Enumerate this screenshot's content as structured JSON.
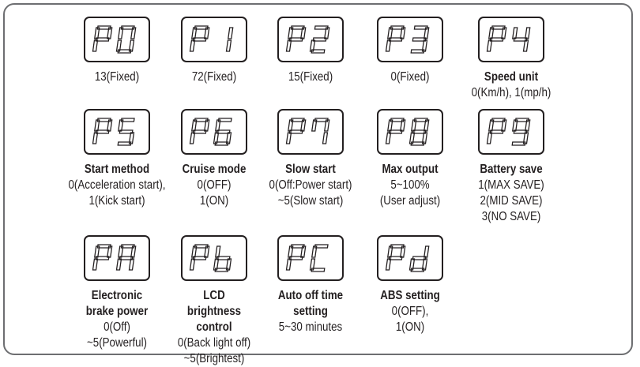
{
  "params": [
    {
      "code": "P0",
      "title": "",
      "values": [
        "13(Fixed)"
      ]
    },
    {
      "code": "P1",
      "title": "",
      "values": [
        "72(Fixed)"
      ]
    },
    {
      "code": "P2",
      "title": "",
      "values": [
        "15(Fixed)"
      ]
    },
    {
      "code": "P3",
      "title": "",
      "values": [
        "0(Fixed)"
      ]
    },
    {
      "code": "P4",
      "title": "Speed unit",
      "values": [
        "0(Km/h), 1(mp/h)"
      ]
    },
    {
      "code": "P5",
      "title": "Start method",
      "values": [
        "0(Acceleration start),",
        "1(Kick start)"
      ]
    },
    {
      "code": "P6",
      "title": "Cruise mode",
      "values": [
        "0(OFF)",
        "1(ON)"
      ]
    },
    {
      "code": "P7",
      "title": "Slow start",
      "values": [
        "0(Off:Power start)",
        "~5(Slow start)"
      ]
    },
    {
      "code": "P8",
      "title": "Max output",
      "values": [
        "5~100%",
        "(User adjust)"
      ]
    },
    {
      "code": "P9",
      "title": "Battery save",
      "values": [
        "1(MAX SAVE)",
        "2(MID SAVE)",
        "3(NO SAVE)"
      ]
    },
    {
      "code": "PA",
      "title": "Electronic brake power",
      "values": [
        "0(Off)",
        "~5(Powerful)"
      ]
    },
    {
      "code": "Pb",
      "title": "LCD brightness control",
      "values": [
        "0(Back light off)",
        "~5(Brightest)"
      ]
    },
    {
      "code": "PC",
      "title": "Auto off time setting",
      "values": [
        "5~30 minutes"
      ]
    },
    {
      "code": "Pd",
      "title": "ABS setting",
      "values": [
        "0(OFF),",
        "1(ON)"
      ]
    }
  ]
}
